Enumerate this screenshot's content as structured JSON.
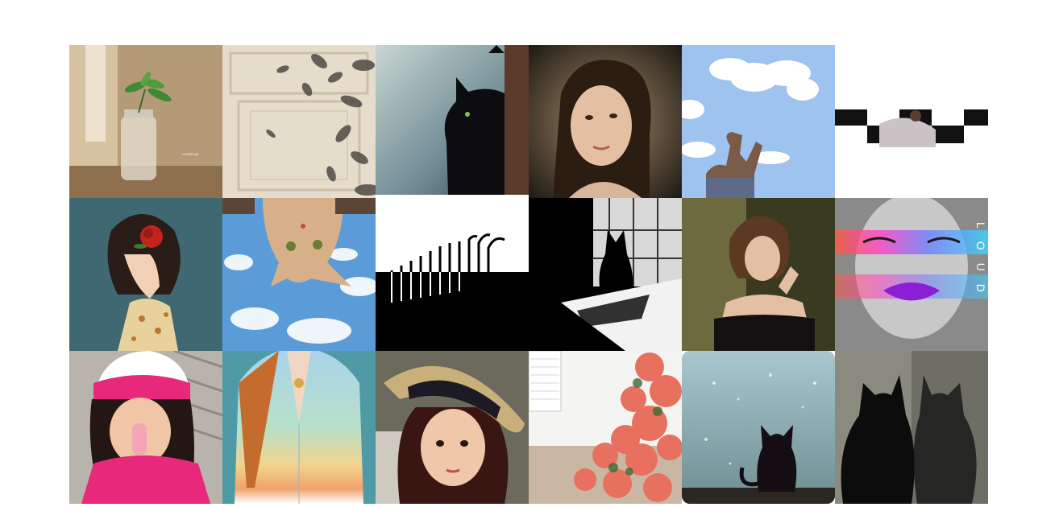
{
  "gallery": {
    "columns": 6,
    "rows": 3,
    "tiles": [
      {
        "subject": "plant-in-jar-photo",
        "watermark": "LOVER ME"
      },
      {
        "subject": "leaf-shadow-on-door-photo"
      },
      {
        "subject": "black-cat-at-window-photo"
      },
      {
        "subject": "girl-portrait-photo"
      },
      {
        "subject": "man-under-clouds-photo"
      },
      {
        "subject": "woman-on-checkered-floor-photo"
      },
      {
        "subject": "anime-girl-with-rose-illustration"
      },
      {
        "subject": "upside-down-kitten-sky-photo"
      },
      {
        "subject": "burnt-matches-photo"
      },
      {
        "subject": "cat-silhouette-window-photo"
      },
      {
        "subject": "woman-off-shoulder-dress-photo"
      },
      {
        "subject": "neon-lips-portrait-photo",
        "overlay_text": "LOUD"
      },
      {
        "subject": "girl-with-popsicle-photo"
      },
      {
        "subject": "pastel-blazer-photo"
      },
      {
        "subject": "girl-in-straw-hat-photo"
      },
      {
        "subject": "pink-flowers-wall-photo"
      },
      {
        "subject": "cat-silhouette-rain-window-photo"
      },
      {
        "subject": "black-cat-reflection-photo"
      }
    ]
  }
}
